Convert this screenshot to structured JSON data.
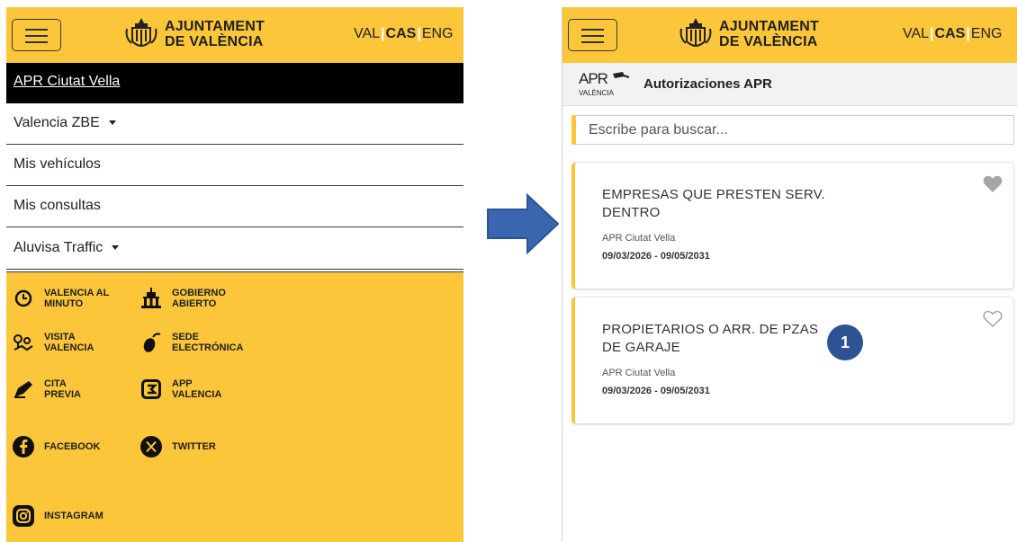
{
  "header": {
    "logo_line1": "AJUNTAMENT",
    "logo_line2": "DE VALÈNCIA",
    "lang_val": "VAL",
    "lang_cas": "CAS",
    "lang_eng": "ENG",
    "lang_sep": "|"
  },
  "left_menu": {
    "active_item": "APR Ciutat Vella",
    "items": [
      {
        "label": "Valencia ZBE",
        "dropdown": true
      },
      {
        "label": "Mis vehículos",
        "dropdown": false
      },
      {
        "label": "Mis consultas",
        "dropdown": false
      },
      {
        "label": "Aluvisa Traffic",
        "dropdown": true
      }
    ]
  },
  "footer_links": {
    "valencia_al_minuto": "VALENCIA AL\nMINUTO",
    "gobierno_abierto": "GOBIERNO\nABIERTO",
    "visita_valencia": "VISITA\nVALENCIA",
    "sede_electronica": "SEDE\nELECTRÓNICA",
    "cita_previa": "CITA\nPREVIA",
    "app_valencia": "APP\nVALENCIA",
    "facebook": "FACEBOOK",
    "twitter": "TWITTER",
    "instagram": "INSTAGRAM"
  },
  "right_view": {
    "apr_logo": "APR",
    "apr_logo_sub": "VALÈNCIA",
    "title": "Autorizaciones APR",
    "search_placeholder": "Escribe para buscar...",
    "cards": [
      {
        "title": "EMPRESAS QUE PRESTEN SERV. DENTRO",
        "zone": "APR Ciutat Vella",
        "dates": "09/03/2026 - 09/05/2031",
        "favorite": true
      },
      {
        "title": "PROPIETARIOS O ARR. DE PZAS DE GARAJE",
        "zone": "APR Ciutat Vella",
        "dates": "09/03/2026 - 09/05/2031",
        "favorite": false
      }
    ],
    "step_badge": "1"
  },
  "colors": {
    "brand_yellow": "#fcc63b",
    "arrow_blue": "#3a66b0",
    "badge_blue": "#2e5395"
  }
}
